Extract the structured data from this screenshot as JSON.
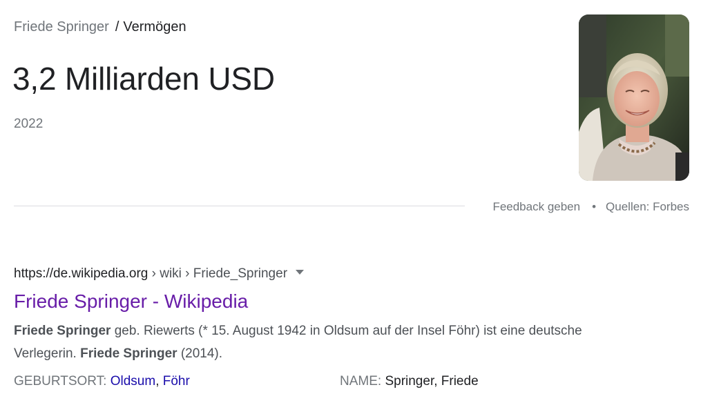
{
  "breadcrumb": {
    "entity": "Friede Springer",
    "separator": "/",
    "attribute": "Vermögen"
  },
  "answer": {
    "value": "3,2 Milliarden USD",
    "year": "2022"
  },
  "footer": {
    "feedback": "Feedback geben",
    "dot": "•",
    "sources": "Quellen: Forbes"
  },
  "result": {
    "url_domain": "https://de.wikipedia.org",
    "url_path": " › wiki › Friede_Springer",
    "title": "Friede Springer - Wikipedia",
    "snippet": {
      "b1": "Friede Springer",
      "t1": " geb. Riewerts (* 15. August 1942 in Oldsum auf der Insel Föhr) ist eine deutsche Verlegerin. ",
      "b2": "Friede Springer",
      "t2": " (2014)."
    }
  },
  "facts": {
    "birthplace": {
      "label": "GEBURTSORT: ",
      "link1": "Oldsum",
      "sep": ", ",
      "link2": "Föhr"
    },
    "name": {
      "label": "NAME: ",
      "value": "Springer, Friede"
    }
  },
  "colors": {
    "link_visited": "#681da8",
    "link": "#1a0dab",
    "secondary_text": "#70757a"
  }
}
